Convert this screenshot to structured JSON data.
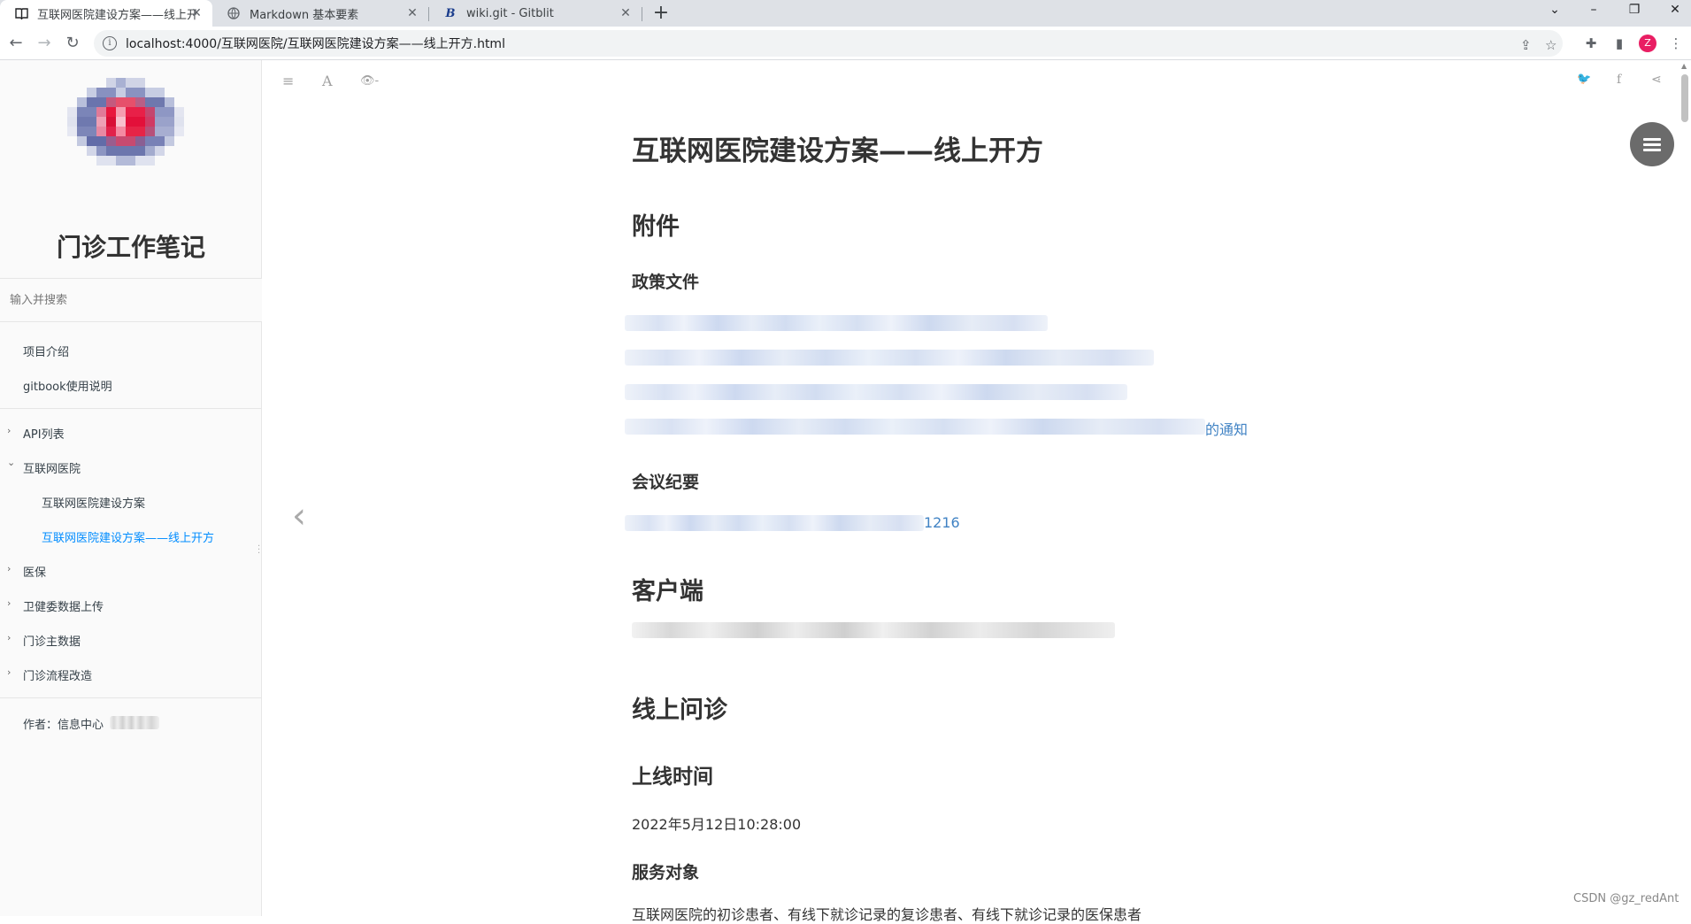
{
  "browser": {
    "tabs": [
      {
        "title": "互联网医院建设方案——线上开方",
        "icon": "book-icon",
        "active": true
      },
      {
        "title": "Markdown 基本要素",
        "icon": "globe-icon",
        "active": false
      },
      {
        "title": "wiki.git - Gitblit",
        "icon": "gitblit-b-icon",
        "active": false
      }
    ],
    "new_tab_symbol": "+",
    "close_symbol": "✕",
    "url": "localhost:4000/互联网医院/互联网医院建设方案——线上开方.html",
    "profile_initial": "Z"
  },
  "sidebar": {
    "site_title": "门诊工作笔记",
    "search_placeholder": "输入并搜索",
    "items": [
      {
        "label": "项目介绍",
        "level": 1,
        "chevron": ""
      },
      {
        "label": "gitbook使用说明",
        "level": 1,
        "chevron": ""
      },
      {
        "label": "API列表",
        "level": 1,
        "chevron": "›"
      },
      {
        "label": "互联网医院",
        "level": 1,
        "chevron": "⌄"
      },
      {
        "label": "互联网医院建设方案",
        "level": 2,
        "chevron": ""
      },
      {
        "label": "互联网医院建设方案——线上开方",
        "level": 2,
        "chevron": "",
        "active": true
      },
      {
        "label": "医保",
        "level": 1,
        "chevron": "›"
      },
      {
        "label": "卫健委数据上传",
        "level": 1,
        "chevron": "›"
      },
      {
        "label": "门诊主数据",
        "level": 1,
        "chevron": "›"
      },
      {
        "label": "门诊流程改造",
        "level": 1,
        "chevron": "›"
      }
    ],
    "author": "作者：信息中心"
  },
  "article": {
    "title": "互联网医院建设方案——线上开方",
    "h_attachments": "附件",
    "h_policy": "政策文件",
    "policy_link_tail": "的通知",
    "h_minutes": "会议纪要",
    "minutes_link_tail": "1216",
    "h_client": "客户端",
    "h_online": "线上问诊",
    "h_launch": "上线时间",
    "launch_time": "2022年5月12日10:28:00",
    "h_target": "服务对象",
    "target_text": "互联网医院的初诊患者、有线下就诊记录的复诊患者、有线下就诊记录的医保患者"
  },
  "watermark": "CSDN @gz_redAnt",
  "colors": {
    "link": "#4183c4",
    "active_nav": "#008cff",
    "profile": "#e91e63"
  }
}
